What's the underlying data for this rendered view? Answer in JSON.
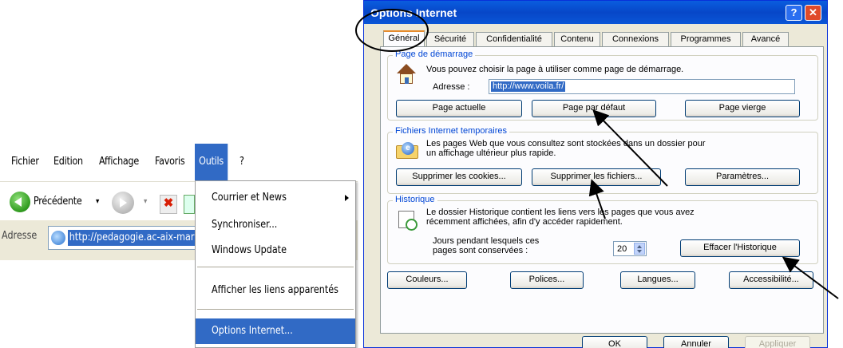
{
  "menubar": {
    "items": [
      "Fichier",
      "Edition",
      "Affichage",
      "Favoris",
      "Outils",
      "?"
    ]
  },
  "toolbar": {
    "back_label": "Précédente",
    "back_dropdown": "▾",
    "fwd_dropdown": "▾"
  },
  "addressbar": {
    "label": "Adresse",
    "url": "http://pedagogie.ac-aix-mars"
  },
  "tools_menu": {
    "items": [
      "Courrier et News",
      "Synchroniser...",
      "Windows Update",
      "Afficher les liens apparentés",
      "Options Internet..."
    ]
  },
  "dialog": {
    "title": "Options Internet",
    "help_btn": "?",
    "close_btn": "✕",
    "tabs": [
      "Général",
      "Sécurité",
      "Confidentialité",
      "Contenu",
      "Connexions",
      "Programmes",
      "Avancé"
    ],
    "home": {
      "title": "Page de démarrage",
      "desc": "Vous pouvez choisir la page à utiliser comme page de démarrage.",
      "address_label": "Adresse :",
      "address_value": "http://www.voila.fr/",
      "btn_current": "Page actuelle",
      "btn_default": "Page par défaut",
      "btn_blank": "Page vierge"
    },
    "temp": {
      "title": "Fichiers Internet temporaires",
      "desc_line1": "Les pages Web que vous consultez sont stockées dans un dossier pour",
      "desc_line2": "un affichage ultérieur plus rapide.",
      "btn_cookies": "Supprimer les cookies...",
      "btn_files": "Supprimer les fichiers...",
      "btn_settings": "Paramètres..."
    },
    "history": {
      "title": "Historique",
      "desc_line1": "Le dossier Historique contient les liens vers les pages que vous avez",
      "desc_line2": "récemment affichées, afin d'y accéder rapidement.",
      "days_line1": "Jours pendant lesquels ces",
      "days_line2": "pages sont conservées :",
      "days_value": "20",
      "btn_clear": "Effacer l'Historique"
    },
    "bottom_buttons": [
      "Couleurs...",
      "Polices...",
      "Langues...",
      "Accessibilité..."
    ],
    "footer_buttons": [
      "OK",
      "Annuler",
      "Appliquer"
    ]
  }
}
